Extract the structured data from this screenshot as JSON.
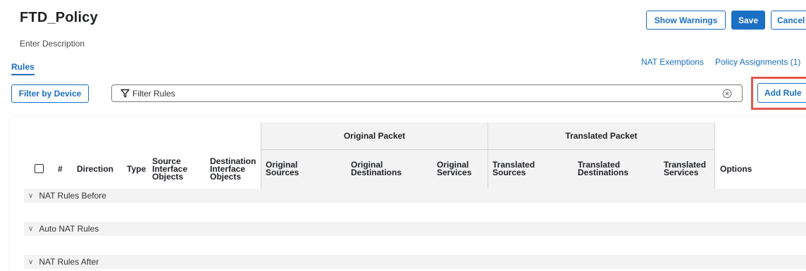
{
  "header": {
    "title": "FTD_Policy",
    "description": "Enter Description",
    "show_warnings": "Show Warnings",
    "save": "Save",
    "cancel": "Cancel"
  },
  "tabs": {
    "rules": "Rules"
  },
  "top_links": {
    "nat_exemptions": "NAT Exemptions",
    "policy_assignments": "Policy Assignments (1)"
  },
  "toolbar": {
    "filter_by_device": "Filter by Device",
    "filter_placeholder": "Filter Rules",
    "add_rule": "Add Rule"
  },
  "table": {
    "groups": {
      "original": "Original Packet",
      "translated": "Translated Packet"
    },
    "columns": {
      "number": "#",
      "direction": "Direction",
      "type": "Type",
      "source_interface": [
        "Source",
        "Interface",
        "Objects"
      ],
      "destination_interface": [
        "Destination",
        "Interface",
        "Objects"
      ],
      "original_sources": [
        "Original",
        "Sources"
      ],
      "original_destinations": [
        "Original",
        "Destinations"
      ],
      "original_services": [
        "Original",
        "Services"
      ],
      "translated_sources": [
        "Translated",
        "Sources"
      ],
      "translated_destinations": [
        "Translated",
        "Destinations"
      ],
      "translated_services": [
        "Translated",
        "Services"
      ],
      "options": "Options"
    },
    "sections": [
      "NAT Rules Before",
      "Auto NAT Rules",
      "NAT Rules After"
    ]
  },
  "colors": {
    "accent": "#1b6fc4",
    "highlight": "#e2574c",
    "header_bg": "#f3f3f3"
  },
  "icons": {
    "filter": "funnel-icon",
    "clear": "circle-x-icon",
    "section_toggle": "chevron-down-icon"
  }
}
